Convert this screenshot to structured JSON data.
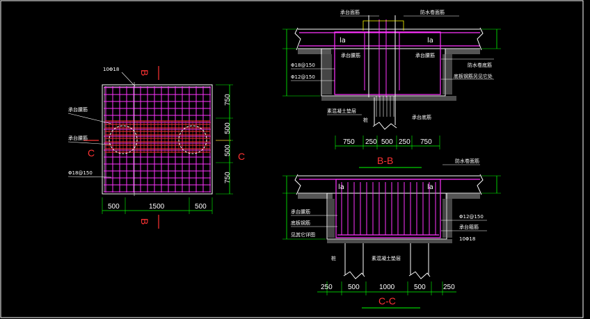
{
  "colors": {
    "background": "#000000",
    "outline": "#ffffff",
    "rebar": "#ff33ff",
    "dense_rebar": "#ff3333",
    "cut_text": "#ff3333",
    "dimension": "#00ff00",
    "hatch": "#9a9a9a",
    "guide": "#ffff00"
  },
  "plan": {
    "top_label": "10Φ18",
    "label_1": "承台腰筋",
    "label_2": "承台腰筋",
    "label_3": "Φ18@150",
    "cut_B_top": "B",
    "cut_B_bottom": "B",
    "cut_C_left": "C",
    "cut_C_right": "C",
    "dims_bottom": [
      "500",
      "1500",
      "500"
    ],
    "dims_right": [
      "750",
      "500",
      "500",
      "750"
    ]
  },
  "section_bb": {
    "title": "B-B",
    "label_top_left": "承台面筋",
    "label_top_right": "防水卷面筋",
    "la_left": "la",
    "la_right": "la",
    "label_l1": "Φ18@150",
    "label_l2": "Φ12@150",
    "label_center": "承台腰筋",
    "label_right_1": "承台腰筋",
    "label_right_2": "防水卷底筋",
    "label_right_3": "底板钢筋另见它处",
    "label_bottom_left": "素混凝土垫层",
    "label_bottom_right": "承台底筋",
    "label_pile": "桩",
    "dims": [
      "750",
      "250",
      "500",
      "250",
      "750"
    ]
  },
  "section_cc": {
    "title": "C-C",
    "label_top_right": "防水卷面筋",
    "la_left": "la",
    "la_right": "la",
    "label_l1": "承台腰筋",
    "label_l2": "底板钢筋",
    "label_l3": "见其它详图",
    "label_r1": "Φ12@150",
    "label_r2": "承台箍筋",
    "label_r3": "10Φ18",
    "label_pile": "桩",
    "label_cushion": "素混凝土垫层",
    "dims": [
      "250",
      "500",
      "1000",
      "500",
      "250"
    ]
  }
}
